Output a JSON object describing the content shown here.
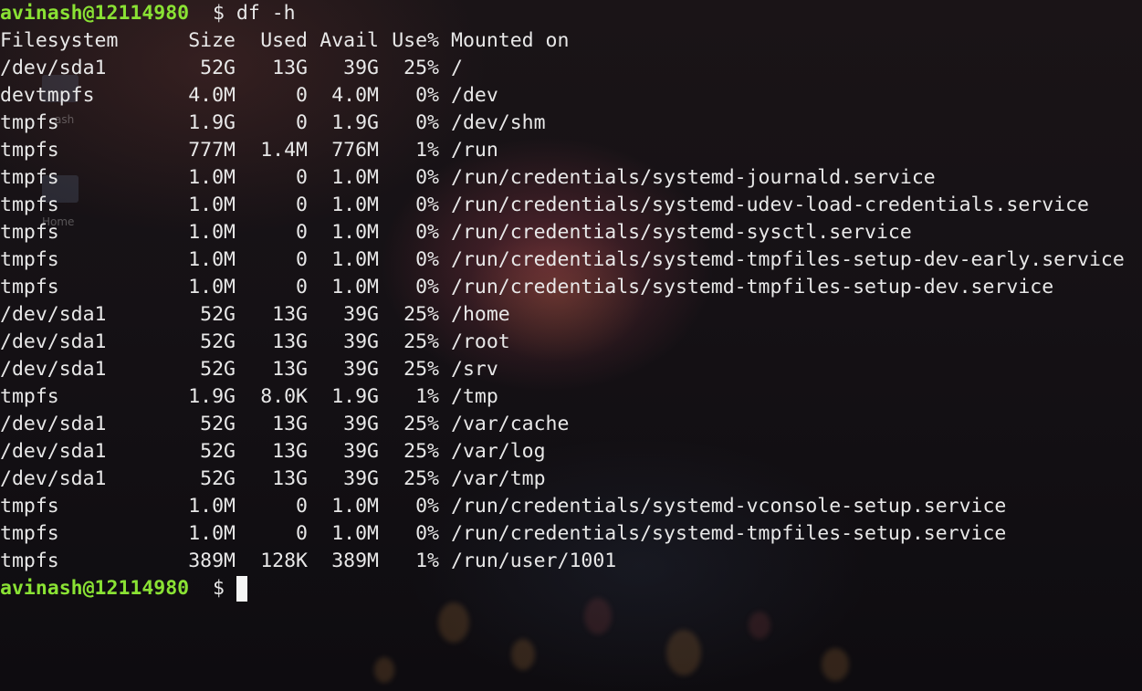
{
  "prompt": {
    "user": "avinash@12114980",
    "symbol": "$",
    "command": "df -h"
  },
  "desktop": {
    "icons": [
      {
        "label": "ash"
      },
      {
        "label": "Home"
      }
    ]
  },
  "table": {
    "headers": {
      "filesystem": "Filesystem",
      "size": "Size",
      "used": "Used",
      "avail": "Avail",
      "use": "Use%",
      "mounted": "Mounted on"
    },
    "rows": [
      {
        "fs": "/dev/sda1",
        "size": "52G",
        "used": "13G",
        "avail": "39G",
        "use": "25%",
        "mnt": "/"
      },
      {
        "fs": "devtmpfs",
        "size": "4.0M",
        "used": "0",
        "avail": "4.0M",
        "use": "0%",
        "mnt": "/dev"
      },
      {
        "fs": "tmpfs",
        "size": "1.9G",
        "used": "0",
        "avail": "1.9G",
        "use": "0%",
        "mnt": "/dev/shm"
      },
      {
        "fs": "tmpfs",
        "size": "777M",
        "used": "1.4M",
        "avail": "776M",
        "use": "1%",
        "mnt": "/run"
      },
      {
        "fs": "tmpfs",
        "size": "1.0M",
        "used": "0",
        "avail": "1.0M",
        "use": "0%",
        "mnt": "/run/credentials/systemd-journald.service"
      },
      {
        "fs": "tmpfs",
        "size": "1.0M",
        "used": "0",
        "avail": "1.0M",
        "use": "0%",
        "mnt": "/run/credentials/systemd-udev-load-credentials.service"
      },
      {
        "fs": "tmpfs",
        "size": "1.0M",
        "used": "0",
        "avail": "1.0M",
        "use": "0%",
        "mnt": "/run/credentials/systemd-sysctl.service"
      },
      {
        "fs": "tmpfs",
        "size": "1.0M",
        "used": "0",
        "avail": "1.0M",
        "use": "0%",
        "mnt": "/run/credentials/systemd-tmpfiles-setup-dev-early.service"
      },
      {
        "fs": "tmpfs",
        "size": "1.0M",
        "used": "0",
        "avail": "1.0M",
        "use": "0%",
        "mnt": "/run/credentials/systemd-tmpfiles-setup-dev.service"
      },
      {
        "fs": "/dev/sda1",
        "size": "52G",
        "used": "13G",
        "avail": "39G",
        "use": "25%",
        "mnt": "/home"
      },
      {
        "fs": "/dev/sda1",
        "size": "52G",
        "used": "13G",
        "avail": "39G",
        "use": "25%",
        "mnt": "/root"
      },
      {
        "fs": "/dev/sda1",
        "size": "52G",
        "used": "13G",
        "avail": "39G",
        "use": "25%",
        "mnt": "/srv"
      },
      {
        "fs": "tmpfs",
        "size": "1.9G",
        "used": "8.0K",
        "avail": "1.9G",
        "use": "1%",
        "mnt": "/tmp"
      },
      {
        "fs": "/dev/sda1",
        "size": "52G",
        "used": "13G",
        "avail": "39G",
        "use": "25%",
        "mnt": "/var/cache"
      },
      {
        "fs": "/dev/sda1",
        "size": "52G",
        "used": "13G",
        "avail": "39G",
        "use": "25%",
        "mnt": "/var/log"
      },
      {
        "fs": "/dev/sda1",
        "size": "52G",
        "used": "13G",
        "avail": "39G",
        "use": "25%",
        "mnt": "/var/tmp"
      },
      {
        "fs": "tmpfs",
        "size": "1.0M",
        "used": "0",
        "avail": "1.0M",
        "use": "0%",
        "mnt": "/run/credentials/systemd-vconsole-setup.service"
      },
      {
        "fs": "tmpfs",
        "size": "1.0M",
        "used": "0",
        "avail": "1.0M",
        "use": "0%",
        "mnt": "/run/credentials/systemd-tmpfiles-setup.service"
      },
      {
        "fs": "tmpfs",
        "size": "389M",
        "used": "128K",
        "avail": "389M",
        "use": "1%",
        "mnt": "/run/user/1001"
      }
    ]
  },
  "colors": {
    "prompt_user": "#8ae234",
    "text": "#e8e8e8",
    "cursor": "#f5f5f5"
  }
}
